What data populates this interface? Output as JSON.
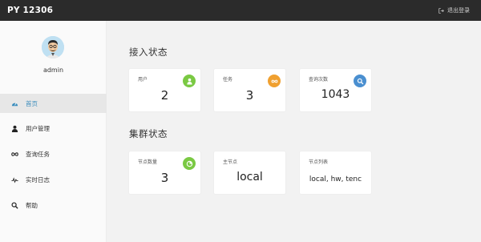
{
  "app": {
    "title": "PY 12306"
  },
  "header": {
    "logout_label": "退出登录"
  },
  "user": {
    "name": "admin"
  },
  "sidebar": {
    "items": [
      {
        "label": "首页",
        "icon": "dashboard-icon"
      },
      {
        "label": "用户管理",
        "icon": "user-icon"
      },
      {
        "label": "查询任务",
        "icon": "infinity-icon"
      },
      {
        "label": "实时日志",
        "icon": "pulse-icon"
      },
      {
        "label": "帮助",
        "icon": "search-icon"
      }
    ]
  },
  "access_status": {
    "title": "接入状态",
    "cards": [
      {
        "label": "用户",
        "value": "2",
        "icon": "user-icon",
        "color": "#7ac943"
      },
      {
        "label": "任务",
        "value": "3",
        "icon": "infinity-icon",
        "color": "#f0a030"
      },
      {
        "label": "查询次数",
        "value": "1043",
        "icon": "search-icon",
        "color": "#4a8fd0"
      }
    ]
  },
  "cluster_status": {
    "title": "集群状态",
    "cards": [
      {
        "label": "节点数量",
        "value": "3",
        "icon": "chart-pie-icon",
        "color": "#7ac943"
      },
      {
        "label": "主节点",
        "value": "local"
      },
      {
        "label": "节点列表",
        "value": "local, hw, tenc"
      }
    ]
  },
  "colors": {
    "topbar": "#2b2b2b",
    "active": "#3c8dbc"
  }
}
